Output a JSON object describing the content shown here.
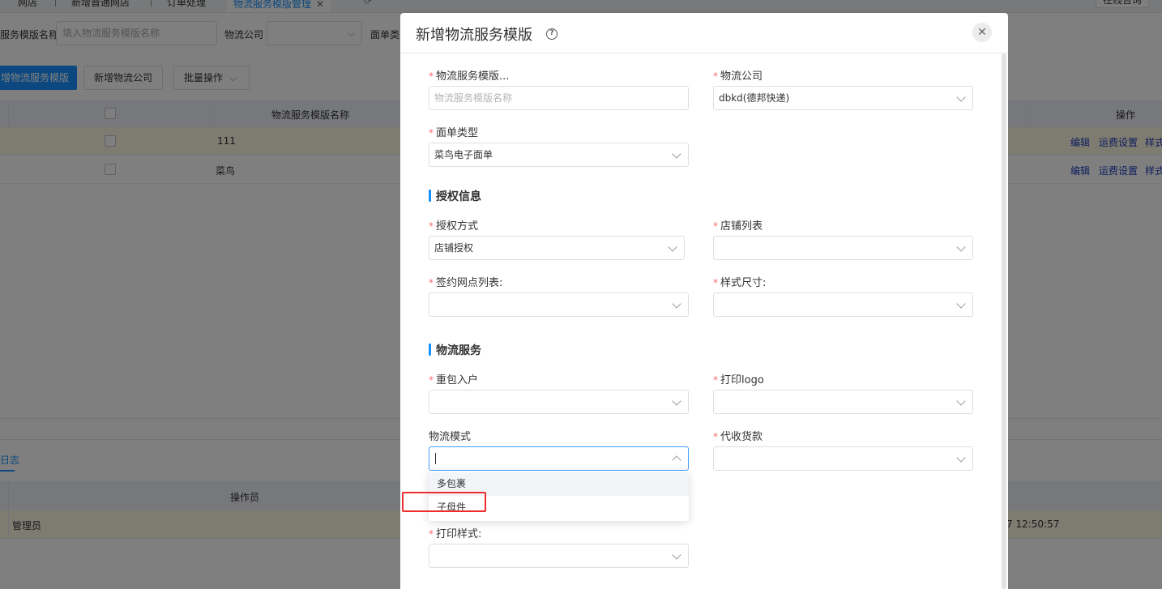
{
  "tabs": [
    {
      "label": "网店"
    },
    {
      "label": "新增普通网店"
    },
    {
      "label": "订单处理"
    },
    {
      "label": "物流服务模版管理",
      "active": true
    }
  ],
  "online_consult": "在线咨询",
  "filters": {
    "name_label": "服务模版名称",
    "name_placeholder": "填入物流服务模版名称",
    "company_label": "物流公司",
    "sheet_label": "面单类"
  },
  "actions": {
    "add_template": "增物流服务模版",
    "add_company": "新增物流公司",
    "batch": "批量操作"
  },
  "table": {
    "col_name": "物流服务模版名称",
    "col_ops": "操作",
    "rows": [
      {
        "name": "111"
      },
      {
        "name": "菜鸟"
      }
    ],
    "op_edit": "编辑",
    "op_fee": "运费设置",
    "op_style": "样式"
  },
  "log": {
    "tab": "日志",
    "col_operator": "操作员",
    "row_operator": "管理员",
    "row_time": "7 12:50:57"
  },
  "dialog": {
    "title": "新增物流服务模版",
    "close": "✕",
    "template_name_label": "物流服务模版...",
    "template_name_placeholder": "物流服务模版名称",
    "company_label": "物流公司",
    "company_value": "dbkd(德邦快递)",
    "sheet_type_label": "面单类型",
    "sheet_type_value": "菜鸟电子面单",
    "auth_section": "授权信息",
    "auth_mode_label": "授权方式",
    "auth_mode_value": "店铺授权",
    "shop_list_label": "店铺列表",
    "outlet_label": "签约网点列表:",
    "size_label": "样式尺寸:",
    "service_section": "物流服务",
    "reweigh_label": "重包入户",
    "print_logo_label": "打印logo",
    "mode_label": "物流模式",
    "cod_label": "代收货款",
    "print_style_label": "打印样式:",
    "mode_options": [
      "多包裹",
      "子母件"
    ]
  }
}
